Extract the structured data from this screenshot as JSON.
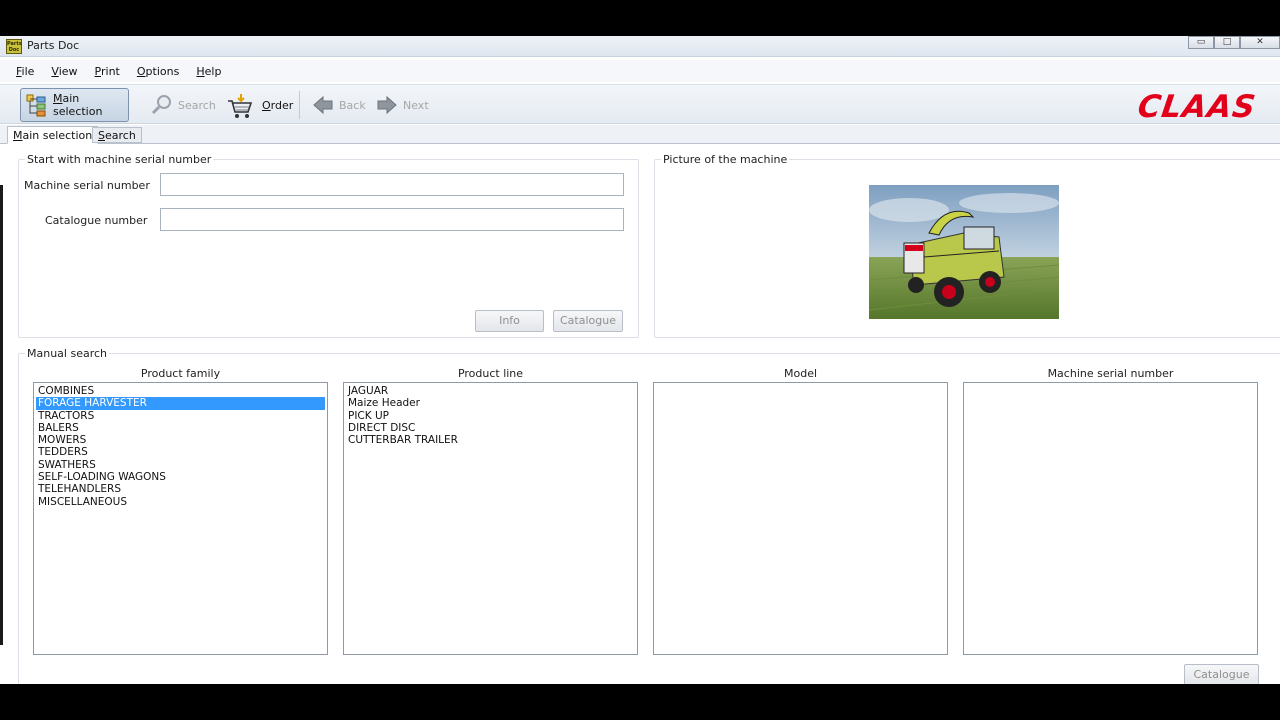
{
  "window": {
    "title": "Parts Doc",
    "app_icon_text": "Parts Doc",
    "controls": {
      "minimize": "▭",
      "maximize": "□",
      "close": "✕"
    }
  },
  "menu": {
    "items": [
      {
        "key": "F",
        "rest": "ile"
      },
      {
        "key": "V",
        "rest": "iew"
      },
      {
        "key": "P",
        "rest": "rint"
      },
      {
        "key": "O",
        "rest": "ptions"
      },
      {
        "key": "H",
        "rest": "elp"
      }
    ]
  },
  "toolbar": {
    "main_selection": {
      "key": "M",
      "rest": "ain selection"
    },
    "search": "Search",
    "order": {
      "key": "O",
      "rest": "rder"
    },
    "back": "Back",
    "next": "Next",
    "logo": "CLAAS"
  },
  "tabs": [
    {
      "key": "M",
      "rest": "ain selection"
    },
    {
      "key": "S",
      "rest": "earch"
    }
  ],
  "serial_group": {
    "title": "Start with machine serial number",
    "machine_serial_label": "Machine serial number",
    "machine_serial_value": "",
    "catalogue_number_label": "Catalogue number",
    "catalogue_number_value": "",
    "info_button": "Info",
    "catalogue_button": "Catalogue"
  },
  "picture_group": {
    "title": "Picture of the machine"
  },
  "manual_search": {
    "title": "Manual search",
    "columns": {
      "product_family": "Product family",
      "product_line": "Product line",
      "model": "Model",
      "machine_serial": "Machine serial number"
    },
    "product_family": [
      "COMBINES",
      "FORAGE HARVESTER",
      "TRACTORS",
      "BALERS",
      "MOWERS",
      "TEDDERS",
      "SWATHERS",
      "SELF-LOADING WAGONS",
      "TELEHANDLERS",
      "MISCELLANEOUS"
    ],
    "product_family_selected": 1,
    "product_line": [
      "JAGUAR",
      "Maize Header",
      "PICK UP",
      "DIRECT DISC",
      "CUTTERBAR TRAILER"
    ],
    "model": [],
    "machine_serial": [],
    "catalogue_button": "Catalogue"
  },
  "colors": {
    "accent": "#e2001a",
    "selection": "#3399ff"
  }
}
